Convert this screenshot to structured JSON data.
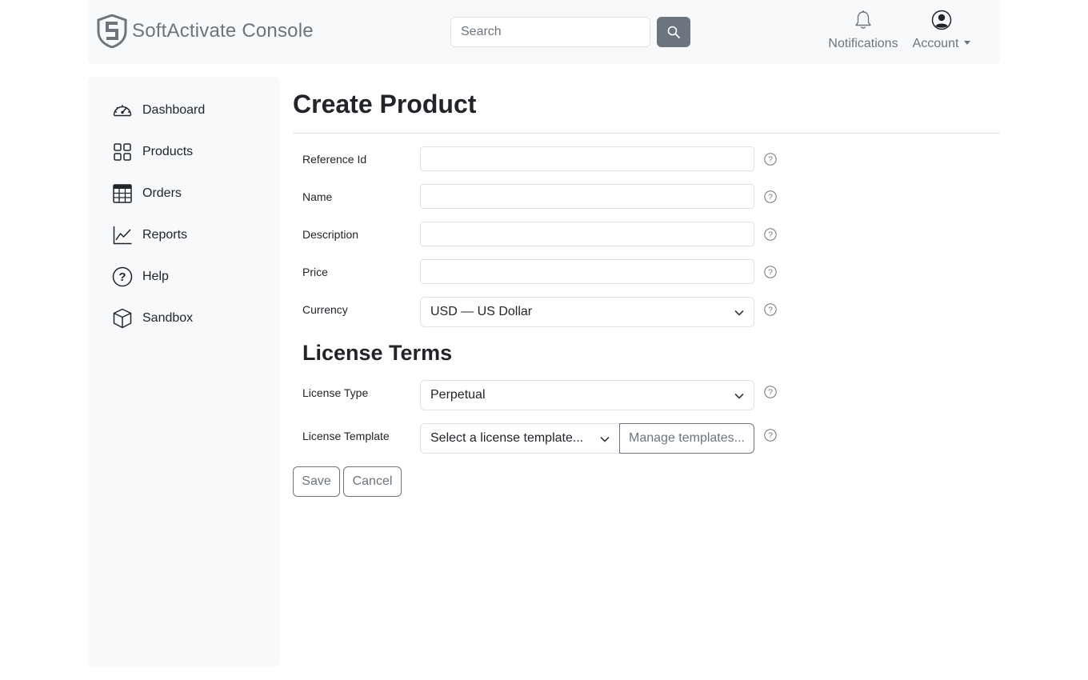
{
  "header": {
    "brand_name": "SoftActivate Console",
    "search_placeholder": "Search",
    "notifications_label": "Notifications",
    "account_label": "Account"
  },
  "sidebar": {
    "items": [
      {
        "label": "Dashboard",
        "icon": "speedometer-icon"
      },
      {
        "label": "Products",
        "icon": "grid-icon"
      },
      {
        "label": "Orders",
        "icon": "table-icon"
      },
      {
        "label": "Reports",
        "icon": "graph-icon"
      },
      {
        "label": "Help",
        "icon": "question-circle-icon"
      },
      {
        "label": "Sandbox",
        "icon": "box-icon"
      }
    ]
  },
  "page": {
    "title": "Create Product",
    "fields": [
      {
        "label": "Reference Id",
        "value": ""
      },
      {
        "label": "Name",
        "value": ""
      },
      {
        "label": "Description",
        "value": ""
      },
      {
        "label": "Price",
        "value": ""
      }
    ],
    "currency": {
      "label": "Currency",
      "selected": "USD — US Dollar"
    },
    "license_section_title": "License Terms",
    "license_type": {
      "label": "License Type",
      "selected": "Perpetual"
    },
    "license_template": {
      "label": "License Template",
      "selected": "Select a license template...",
      "manage_label": "Manage templates..."
    },
    "save_label": "Save",
    "cancel_label": "Cancel"
  },
  "colors": {
    "panel_bg": "#f8f9fa",
    "secondary": "#6c757d",
    "border": "#dee2e6",
    "text": "#212529"
  }
}
